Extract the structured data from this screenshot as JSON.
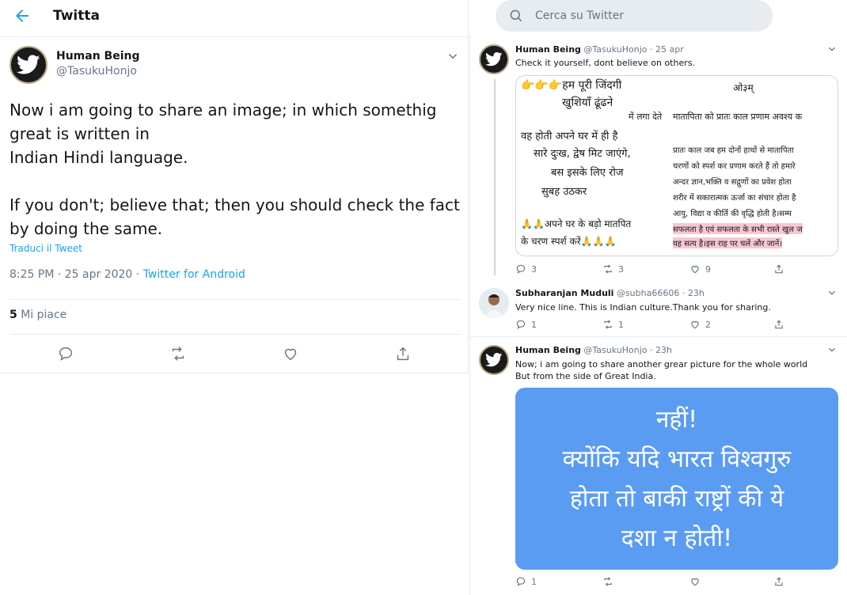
{
  "header": {
    "title": "Twitta"
  },
  "main_tweet": {
    "name": "Human Being",
    "handle": "@TasukuHonjo",
    "text": "Now i am going to share an image; in which somethig great is written in\nIndian Hindi language.\n\nIf you don't; believe that; then you should check the fact by doing the same.",
    "translate_label": "Traduci il Tweet",
    "time": "8:25 PM · 25 apr 2020 · ",
    "source": "Twitter for Android",
    "likes_count": "5",
    "likes_label": "Mi piace"
  },
  "search": {
    "placeholder": "Cerca su Twitter"
  },
  "replies": [
    {
      "name": "Human Being",
      "handle": "@TasukuHonjo",
      "time": "· 25 apr",
      "text": "Check it yourself, dont believe on others.",
      "reply_count": "3",
      "retweet_count": "3",
      "like_count": "9",
      "image_text": {
        "l1": "👉👉👉हम पूरी जिंदगी",
        "l2": "खुशियाँ ढूंढने",
        "l3": "में लगा देते",
        "l4": "वह होती अपने घर में ही है",
        "l5": "सारे दुःख,  द्वेष मिट जाएंगे,",
        "l6": "बस इसके लिए रोज",
        "l7": "सुबह उठकर",
        "l8": "🙏🙏अपने घर के बड़ो मातपित",
        "l9": "के चरण स्पर्श करें🙏🙏🙏",
        "r0": "ओ३म्",
        "r1": "मातापिता को प्रातः काल प्रणाम अवश्य क",
        "r2": "प्रातः काल जब हम दोनों हाथों से मातापिता",
        "r3": "चरणों को स्पर्श कर प्रणाम करते हैं तो हमारे",
        "r4": "अन्दर ज्ञान,भक्ति व सद्गुणों का प्रवेश होता",
        "r5": "शरीर में सकारात्मक ऊर्जा का संचार होता है",
        "r6": "आयु, विद्या व कीर्ति की वृद्धि होती है।सम्म",
        "r7": "सफलता है एवं सफलता के सभी रास्ते खुल ज",
        "r8": "यह सत्य है।इस राह पर चलें और जानें।"
      }
    },
    {
      "name": "Subharanjan Muduli",
      "handle": "@subha66606",
      "time": "· 23h",
      "text": "Very nice line. This is Indian culture.Thank you for sharing.",
      "reply_count": "1",
      "retweet_count": "1",
      "like_count": "2"
    },
    {
      "name": "Human Being",
      "handle": "@TasukuHonjo",
      "time": "· 23h",
      "text": "Now; i am going to share another grear picture for the whole world\nBut from the side of Great India.",
      "reply_count": "1",
      "image_text": {
        "l1": "नहीं!",
        "l2": "क्योंकि यदि भारत विश्वगुरु",
        "l3": "होता तो बाकी राष्ट्रों की ये",
        "l4": "दशा न होती!"
      }
    }
  ]
}
